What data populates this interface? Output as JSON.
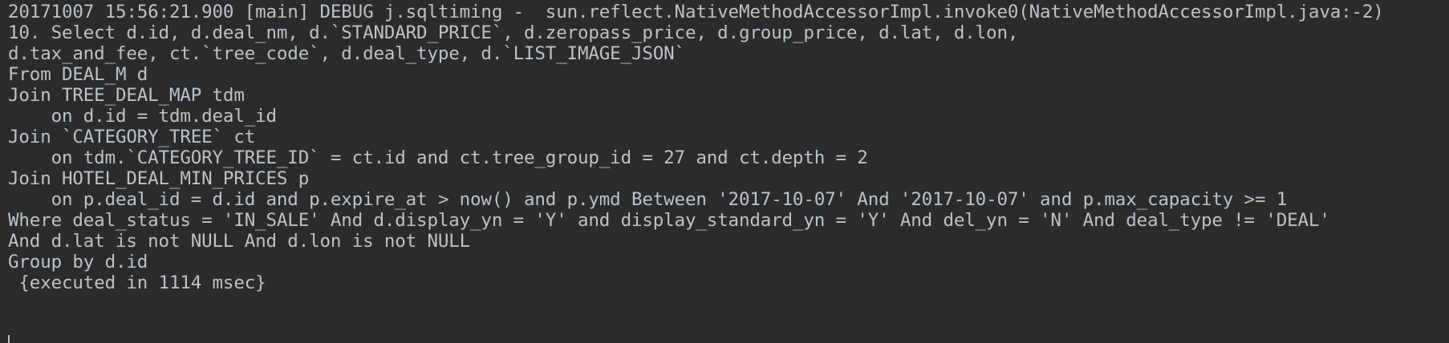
{
  "console": {
    "lines": [
      "20171007 15:56:21.900 [main] DEBUG j.sqltiming -  sun.reflect.NativeMethodAccessorImpl.invoke0(NativeMethodAccessorImpl.java:-2)",
      "10. Select d.id, d.deal_nm, d.`STANDARD_PRICE`, d.zeropass_price, d.group_price, d.lat, d.lon,",
      "d.tax_and_fee, ct.`tree_code`, d.deal_type, d.`LIST_IMAGE_JSON`",
      "From DEAL_M d",
      "Join TREE_DEAL_MAP tdm",
      "    on d.id = tdm.deal_id",
      "Join `CATEGORY_TREE` ct",
      "    on tdm.`CATEGORY_TREE_ID` = ct.id and ct.tree_group_id = 27 and ct.depth = 2",
      "Join HOTEL_DEAL_MIN_PRICES p",
      "    on p.deal_id = d.id and p.expire_at > now() and p.ymd Between '2017-10-07' And '2017-10-07' and p.max_capacity >= 1",
      "Where deal_status = 'IN_SALE' And d.display_yn = 'Y' and display_standard_yn = 'Y' And del_yn = 'N' And deal_type != 'DEAL'",
      "And d.lat is not NULL And d.lon is not NULL",
      "Group by d.id",
      " {executed in 1114 msec}"
    ]
  }
}
